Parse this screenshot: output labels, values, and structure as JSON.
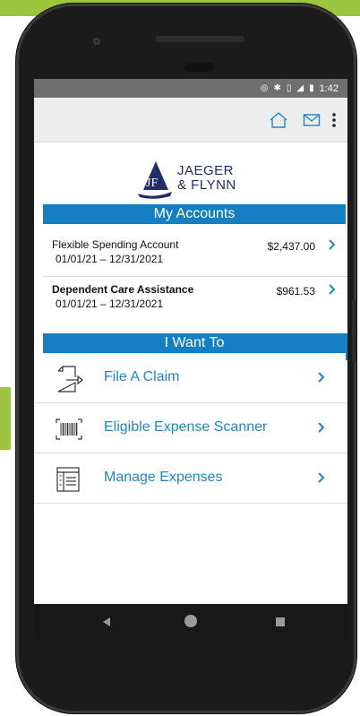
{
  "status_bar": {
    "time": "1:42",
    "icons": [
      "hotspot-icon",
      "bluetooth-icon",
      "vibrate-icon",
      "signal-icon",
      "battery-icon"
    ]
  },
  "header_icons": [
    "home-icon",
    "mail-icon",
    "more-vert-icon"
  ],
  "brand": {
    "monogram": "JF",
    "line1": "JAEGER",
    "line2": "& FLYNN",
    "color": "#1f2e66"
  },
  "my_accounts": {
    "title": "My Accounts",
    "accounts": [
      {
        "name": "Flexible Spending Account",
        "dates": "01/01/21 – 12/31/2021",
        "amount": "$2,437.00"
      },
      {
        "name": "Dependent Care Assistance",
        "dates": "01/01/21 – 12/31/2021",
        "amount": "$961.53"
      }
    ]
  },
  "i_want_to": {
    "title": "I Want To",
    "actions": [
      {
        "label": "File A Claim",
        "icon": "file-claim-icon"
      },
      {
        "label": "Eligible Expense Scanner",
        "icon": "barcode-scanner-icon"
      },
      {
        "label": "Manage Expenses",
        "icon": "manage-expenses-icon"
      }
    ]
  },
  "colors": {
    "accent_blue": "#1480c3",
    "link_blue": "#1f86c8",
    "lime_green": "#9cc640",
    "status_bar": "#6f6f6f",
    "app_bar": "#ededed"
  }
}
